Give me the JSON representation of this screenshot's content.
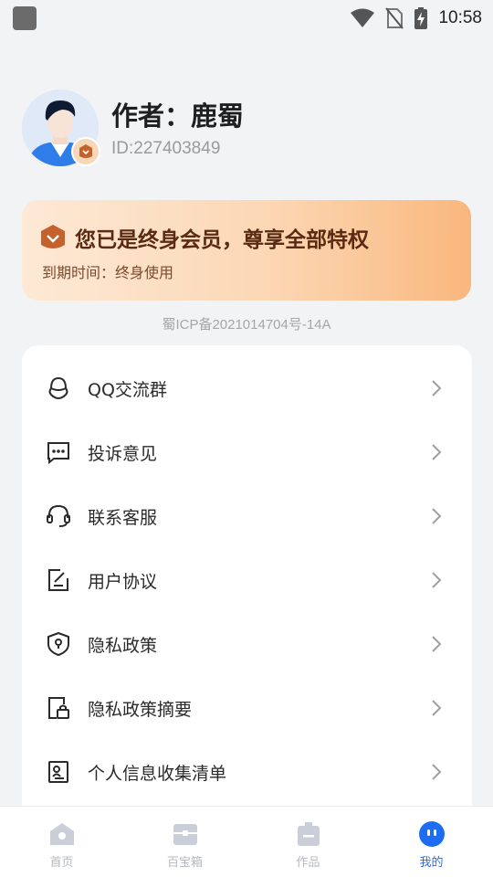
{
  "status_bar": {
    "time": "10:58"
  },
  "profile": {
    "author_name": "作者：鹿蜀",
    "user_id": "ID:227403849"
  },
  "membership": {
    "title": "您已是终身会员，尊享全部特权",
    "expiry": "到期时间：终身使用"
  },
  "icp_text": "蜀ICP备2021014704号-14A",
  "menu": {
    "items": [
      {
        "label": "QQ交流群",
        "icon": "qq-icon"
      },
      {
        "label": "投诉意见",
        "icon": "chat-dots-icon"
      },
      {
        "label": "联系客服",
        "icon": "headset-icon"
      },
      {
        "label": "用户协议",
        "icon": "edit-document-icon"
      },
      {
        "label": "隐私政策",
        "icon": "shield-icon"
      },
      {
        "label": "隐私政策摘要",
        "icon": "lock-document-icon"
      },
      {
        "label": "个人信息收集清单",
        "icon": "id-card-icon"
      }
    ]
  },
  "bottom_nav": {
    "items": [
      {
        "label": "首页",
        "icon": "home-icon"
      },
      {
        "label": "百宝箱",
        "icon": "toolbox-icon"
      },
      {
        "label": "作品",
        "icon": "works-icon"
      },
      {
        "label": "我的",
        "icon": "profile-face-icon",
        "active": true
      }
    ]
  },
  "colors": {
    "accent": "#1d6df2",
    "member_title": "#5a2a12",
    "background": "#f2f3f5"
  }
}
